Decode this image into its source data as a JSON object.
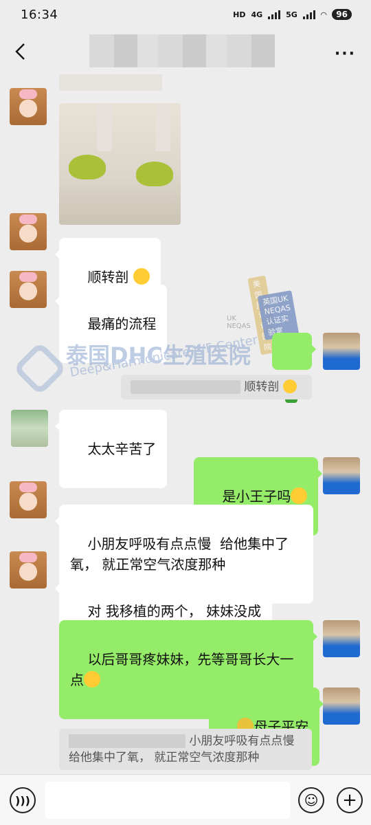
{
  "status_bar": {
    "time": "16:34",
    "net1": "HD",
    "net2": "4G",
    "net3": "5G",
    "battery": "96"
  },
  "header": {
    "title": ""
  },
  "messages": {
    "m1": "顺转剖",
    "m2": "最痛的流程",
    "m3_quote": "顺转剖",
    "m4": "太太辛苦了",
    "m5": "是小王子吗",
    "m6": "小朋友呼吸有点点慢  给他集中了氧， 就正常空气浓度那种",
    "m7": "对 我移植的两个， 妹妹没成",
    "m8": "以后哥哥疼妹妹，先等哥哥长大一点",
    "m9": "母子平安",
    "m10_quote_l1": "小朋友呼吸有点点慢",
    "m10_quote_l2": "给他集中了氧， 就正常空气浓度那种"
  },
  "watermark": {
    "cn": "泰国DHC生殖医院",
    "en": "Deep&Harmonicare IVF Center",
    "badge1": "美国JCI认证医院",
    "badge2": "英国UK NEQAS认证实验室",
    "uk": "UK NEQAS"
  },
  "input": {
    "placeholder": ""
  },
  "colors": {
    "out_bubble": "#95ec69",
    "in_bubble": "#ffffff",
    "bg": "#ededed"
  },
  "icons": {
    "back": "back-arrow-icon",
    "more": "more-icon",
    "voice": "voice-icon",
    "emoji": "emoji-icon",
    "plus": "plus-icon"
  }
}
